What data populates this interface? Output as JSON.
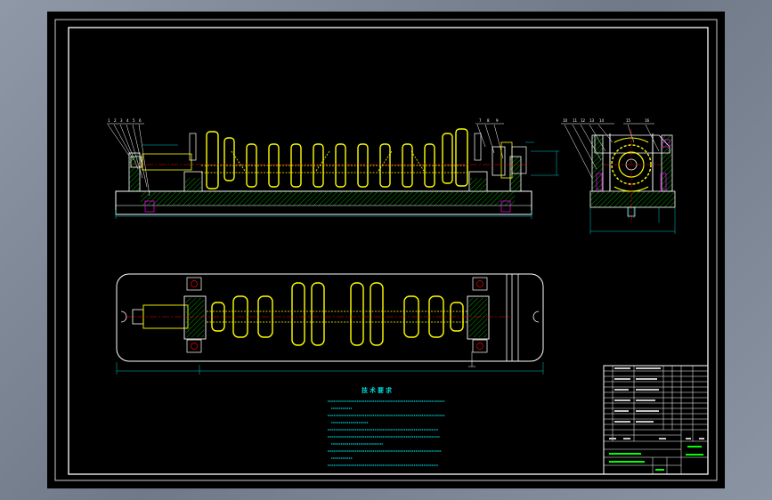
{
  "notes": {
    "title": "技术要求",
    "lines": []
  },
  "title_block": {
    "rows": []
  },
  "colors": {
    "frame": "#ffffff",
    "outline": "#ffffff",
    "part": "#ffff00",
    "center_line": "#ff0000",
    "hatch": "#00ff00",
    "dimension": "#00c8c8",
    "highlight": "#ff00ff",
    "background_sheet": "#000000",
    "screen_bg": "#7d8795"
  },
  "icons": [
    "drawing-sheet",
    "crankshaft-fixture"
  ]
}
